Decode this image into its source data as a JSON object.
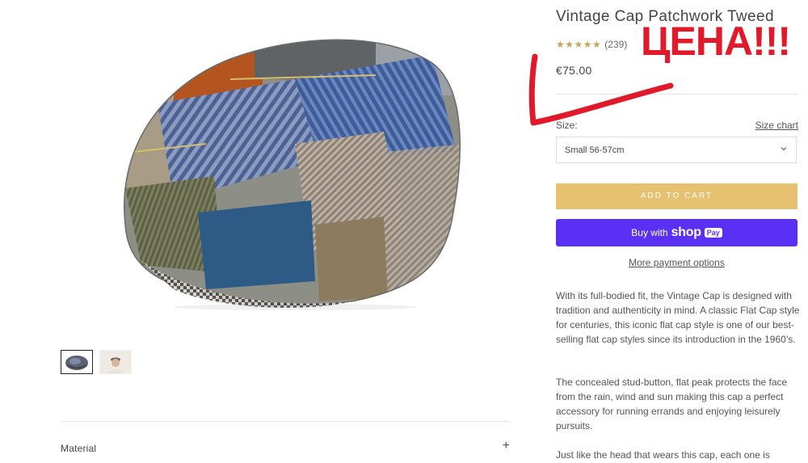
{
  "product": {
    "title": "Vintage Cap Patchwork Tweed",
    "rating_count": "(239)",
    "price": "€75.00",
    "size_label": "Size:",
    "size_chart_link": "Size chart",
    "size_selected": "Small 56-57cm",
    "add_to_cart": "ADD TO CART",
    "buy_with_prefix": "Buy with",
    "shop_word": "shop",
    "pay_badge": "Pay",
    "more_payment": "More payment options",
    "description": [
      "With its full-bodied fit, the Vintage Cap is designed with tradition and authenticity in mind. A classic Flat Cap style for centuries, this iconic flat cap style is one of our best-selling flat cap styles since its introduction in the 1960’s.",
      "The concealed stud-button, flat peak protects the face from the rain, wind and sun making this cap a perfect accessory for running errands and enjoying leisurely pursuits.",
      "Just like the head that wears this cap, each one is"
    ]
  },
  "media": {
    "accordion_label": "Material",
    "accordion_icon": "plus-icon",
    "thumbnails": [
      "cap-thumbnail",
      "model-thumbnail"
    ]
  },
  "annotation": {
    "text": "ЦЕНА!!!",
    "color": "#e0192b"
  },
  "colors": {
    "add_to_cart": "#e6c170",
    "shop_pay": "#5a31f4",
    "stars": "#c7a45c"
  }
}
